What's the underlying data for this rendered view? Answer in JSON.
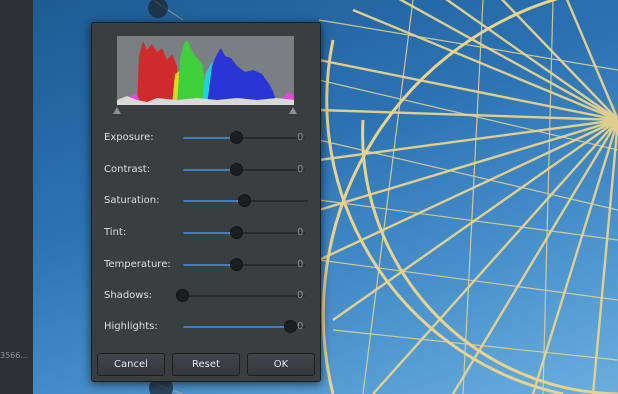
{
  "sidebar": {
    "meta_text": "3566..."
  },
  "dialog": {
    "rows": [
      {
        "label": "Exposure:",
        "value": "0",
        "level": 0.5,
        "centered": true
      },
      {
        "label": "Contrast:",
        "value": "0",
        "level": 0.5,
        "centered": true
      },
      {
        "label": "Saturation:",
        "value": "",
        "level": 0.5,
        "centered": false
      },
      {
        "label": "Tint:",
        "value": "0",
        "level": 0.5,
        "centered": true
      },
      {
        "label": "Temperature:",
        "value": "0",
        "level": 0.5,
        "centered": true
      },
      {
        "label": "Shadows:",
        "value": "0",
        "level": 0.0,
        "centered": false
      },
      {
        "label": "Highlights:",
        "value": "0",
        "level": 1.0,
        "centered": false
      }
    ],
    "buttons": {
      "cancel_label": "Cancel",
      "reset_label": "Reset",
      "ok_label": "OK"
    }
  },
  "colors": {
    "slider_fill": "#3a7fc7",
    "dialog_bg": "#393f3f"
  }
}
